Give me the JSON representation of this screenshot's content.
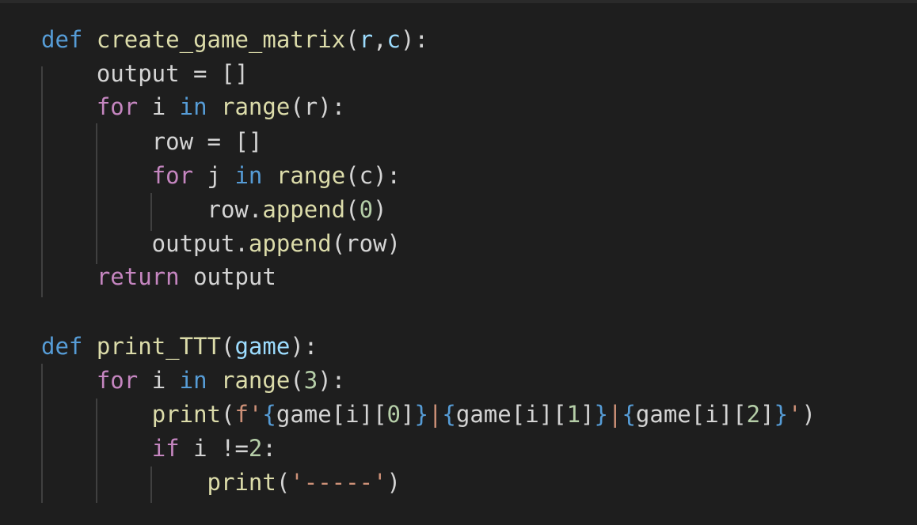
{
  "code": {
    "lines": [
      [
        {
          "t": "def",
          "k": "keyword"
        },
        {
          "t": " ",
          "k": "plain"
        },
        {
          "t": "create_game_matrix",
          "k": "func"
        },
        {
          "t": "(",
          "k": "plain"
        },
        {
          "t": "r",
          "k": "param"
        },
        {
          "t": ",",
          "k": "plain"
        },
        {
          "t": "c",
          "k": "param"
        },
        {
          "t": "):",
          "k": "plain"
        }
      ],
      [
        {
          "t": "    output = []",
          "k": "plain"
        }
      ],
      [
        {
          "t": "    ",
          "k": "plain"
        },
        {
          "t": "for",
          "k": "control"
        },
        {
          "t": " i ",
          "k": "plain"
        },
        {
          "t": "in",
          "k": "keyword"
        },
        {
          "t": " ",
          "k": "plain"
        },
        {
          "t": "range",
          "k": "func"
        },
        {
          "t": "(r):",
          "k": "plain"
        }
      ],
      [
        {
          "t": "        row = []",
          "k": "plain"
        }
      ],
      [
        {
          "t": "        ",
          "k": "plain"
        },
        {
          "t": "for",
          "k": "control"
        },
        {
          "t": " j ",
          "k": "plain"
        },
        {
          "t": "in",
          "k": "keyword"
        },
        {
          "t": " ",
          "k": "plain"
        },
        {
          "t": "range",
          "k": "func"
        },
        {
          "t": "(c):",
          "k": "plain"
        }
      ],
      [
        {
          "t": "            row.",
          "k": "plain"
        },
        {
          "t": "append",
          "k": "func"
        },
        {
          "t": "(",
          "k": "plain"
        },
        {
          "t": "0",
          "k": "number"
        },
        {
          "t": ")",
          "k": "plain"
        }
      ],
      [
        {
          "t": "        output.",
          "k": "plain"
        },
        {
          "t": "append",
          "k": "func"
        },
        {
          "t": "(row)",
          "k": "plain"
        }
      ],
      [
        {
          "t": "    ",
          "k": "plain"
        },
        {
          "t": "return",
          "k": "control"
        },
        {
          "t": " output",
          "k": "plain"
        }
      ],
      [],
      [
        {
          "t": "def",
          "k": "keyword"
        },
        {
          "t": " ",
          "k": "plain"
        },
        {
          "t": "print_TTT",
          "k": "func"
        },
        {
          "t": "(",
          "k": "plain"
        },
        {
          "t": "game",
          "k": "param"
        },
        {
          "t": "):",
          "k": "plain"
        }
      ],
      [
        {
          "t": "    ",
          "k": "plain"
        },
        {
          "t": "for",
          "k": "control"
        },
        {
          "t": " i ",
          "k": "plain"
        },
        {
          "t": "in",
          "k": "keyword"
        },
        {
          "t": " ",
          "k": "plain"
        },
        {
          "t": "range",
          "k": "func"
        },
        {
          "t": "(",
          "k": "plain"
        },
        {
          "t": "3",
          "k": "number"
        },
        {
          "t": "):",
          "k": "plain"
        }
      ],
      [
        {
          "t": "        ",
          "k": "plain"
        },
        {
          "t": "print",
          "k": "func"
        },
        {
          "t": "(",
          "k": "plain"
        },
        {
          "t": "f'",
          "k": "string"
        },
        {
          "t": "{",
          "k": "brace"
        },
        {
          "t": "game[i][",
          "k": "plain"
        },
        {
          "t": "0",
          "k": "number"
        },
        {
          "t": "]",
          "k": "plain"
        },
        {
          "t": "}",
          "k": "brace"
        },
        {
          "t": "|",
          "k": "string"
        },
        {
          "t": "{",
          "k": "brace"
        },
        {
          "t": "game[i][",
          "k": "plain"
        },
        {
          "t": "1",
          "k": "number"
        },
        {
          "t": "]",
          "k": "plain"
        },
        {
          "t": "}",
          "k": "brace"
        },
        {
          "t": "|",
          "k": "string"
        },
        {
          "t": "{",
          "k": "brace"
        },
        {
          "t": "game[i][",
          "k": "plain"
        },
        {
          "t": "2",
          "k": "number"
        },
        {
          "t": "]",
          "k": "plain"
        },
        {
          "t": "}",
          "k": "brace"
        },
        {
          "t": "'",
          "k": "string"
        },
        {
          "t": ")",
          "k": "plain"
        }
      ],
      [
        {
          "t": "        ",
          "k": "plain"
        },
        {
          "t": "if",
          "k": "control"
        },
        {
          "t": " i !=",
          "k": "plain"
        },
        {
          "t": "2",
          "k": "number"
        },
        {
          "t": ":",
          "k": "plain"
        }
      ],
      [
        {
          "t": "            ",
          "k": "plain"
        },
        {
          "t": "print",
          "k": "func"
        },
        {
          "t": "(",
          "k": "plain"
        },
        {
          "t": "'-----'",
          "k": "string"
        },
        {
          "t": ")",
          "k": "plain"
        }
      ]
    ]
  }
}
